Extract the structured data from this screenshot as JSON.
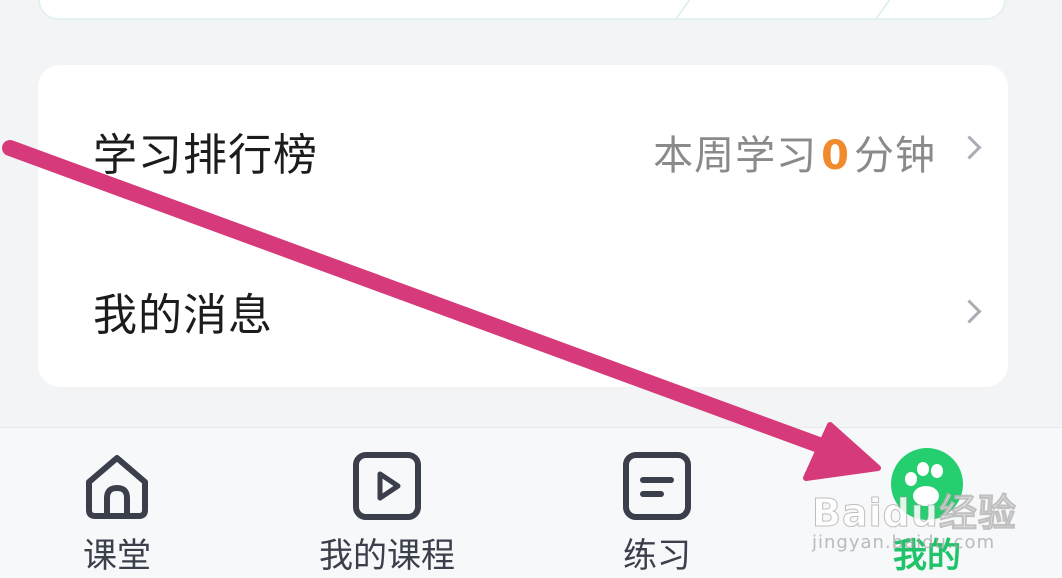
{
  "menu": {
    "ranking": {
      "title": "学习排行榜",
      "status_prefix": "本周学习",
      "minutes": "0",
      "status_suffix": "分钟"
    },
    "messages": {
      "title": "我的消息"
    }
  },
  "tabbar": {
    "items": [
      {
        "label": "课堂",
        "icon": "home-icon",
        "active": false
      },
      {
        "label": "我的课程",
        "icon": "play-video-icon",
        "active": false
      },
      {
        "label": "练习",
        "icon": "practice-document-icon",
        "active": false
      },
      {
        "label": "我的",
        "icon": "profile-paw-icon",
        "active": true
      }
    ]
  },
  "annotation": {
    "arrow_color": "#d63a7a"
  },
  "watermark": {
    "logo": "Baidu经验",
    "url": "jingyan.baidu.com"
  },
  "colors": {
    "accent_green": "#1fc46a",
    "highlight_orange": "#f08a2c",
    "icon_gray": "#3a3f4b"
  }
}
